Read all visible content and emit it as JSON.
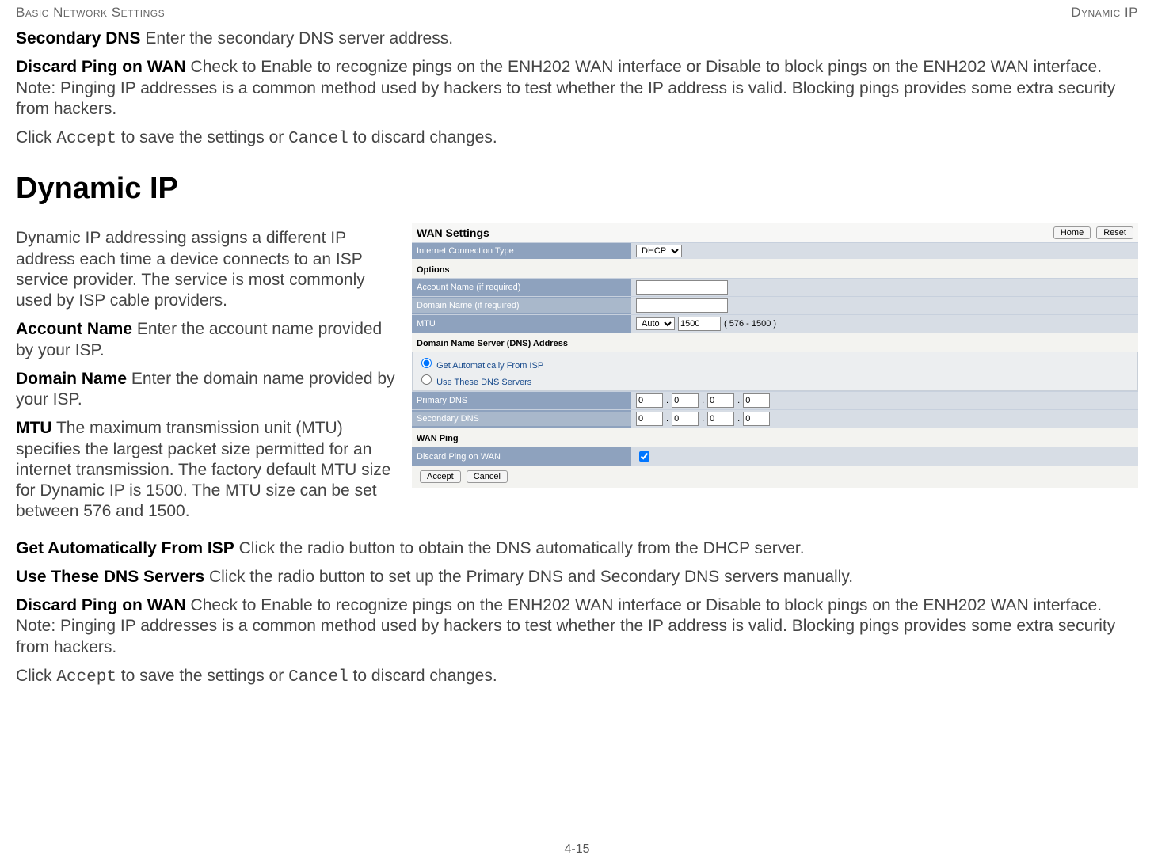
{
  "header": {
    "left": "Basic Network Settings",
    "right": "Dynamic IP"
  },
  "top_paras": {
    "sec_dns_term": "Secondary DNS",
    "sec_dns_text": "  Enter the secondary DNS server address.",
    "discard_term": "Discard Ping on WAN",
    "discard_text": "  Check to Enable to recognize pings on the ENH202 WAN interface or Disable to block pings on the ENH202 WAN interface. Note: Pinging IP addresses is a common method used by hackers to test whether the IP address is valid. Blocking pings provides some extra security from hackers.",
    "click_prefix": "Click ",
    "accept": "Accept",
    "click_mid": " to save the settings or ",
    "cancel": "Cancel",
    "click_end": " to discard changes."
  },
  "section_title": "Dynamic IP",
  "intro": "Dynamic IP addressing assigns a different IP address each time a device connects to an ISP service provider. The service is most commonly used by ISP cable providers.",
  "defs": {
    "account_term": "Account Name",
    "account_text": "  Enter the account name provided by your ISP.",
    "domain_term": "Domain Name",
    "domain_text": "  Enter the domain name provided by your ISP.",
    "mtu_term": "MTU",
    "mtu_text": "  The maximum transmission unit (MTU) specifies the largest packet size permitted for an internet transmission. The factory default MTU size for Dynamic IP is 1500. The MTU size can be set between 576 and 1500.",
    "auto_term": "Get Automatically From ISP",
    "auto_text": "  Click the radio button to obtain the DNS automatically from the DHCP server.",
    "use_term": "Use These DNS Servers",
    "use_text": "  Click the radio button to set up the Primary DNS and Secondary DNS servers manually.",
    "discard_term": "Discard Ping on WAN",
    "discard_text": "  Check to Enable to recognize pings on the ENH202 WAN interface or Disable to block pings on the ENH202 WAN interface. Note: Pinging IP addresses is a common method used by hackers to test whether the IP address is valid. Blocking pings provides some extra security from hackers."
  },
  "ui": {
    "title": "WAN Settings",
    "home": "Home",
    "reset": "Reset",
    "conn_type_label": "Internet Connection Type",
    "conn_type_value": "DHCP",
    "options": "Options",
    "account_label": "Account Name (if required)",
    "domain_label": "Domain Name (if required)",
    "mtu_label": "MTU",
    "mtu_mode": "Auto",
    "mtu_value": "1500",
    "mtu_range": "( 576 - 1500 )",
    "dns_section": "Domain Name Server (DNS) Address",
    "dns_auto": "Get Automatically From ISP",
    "dns_manual": "Use These DNS Servers",
    "primary_dns": "Primary DNS",
    "secondary_dns": "Secondary DNS",
    "dns_oct": "0",
    "wan_ping": "WAN Ping",
    "discard_ping": "Discard Ping on WAN",
    "accept": "Accept",
    "cancel": "Cancel"
  },
  "page_num": "4-15"
}
